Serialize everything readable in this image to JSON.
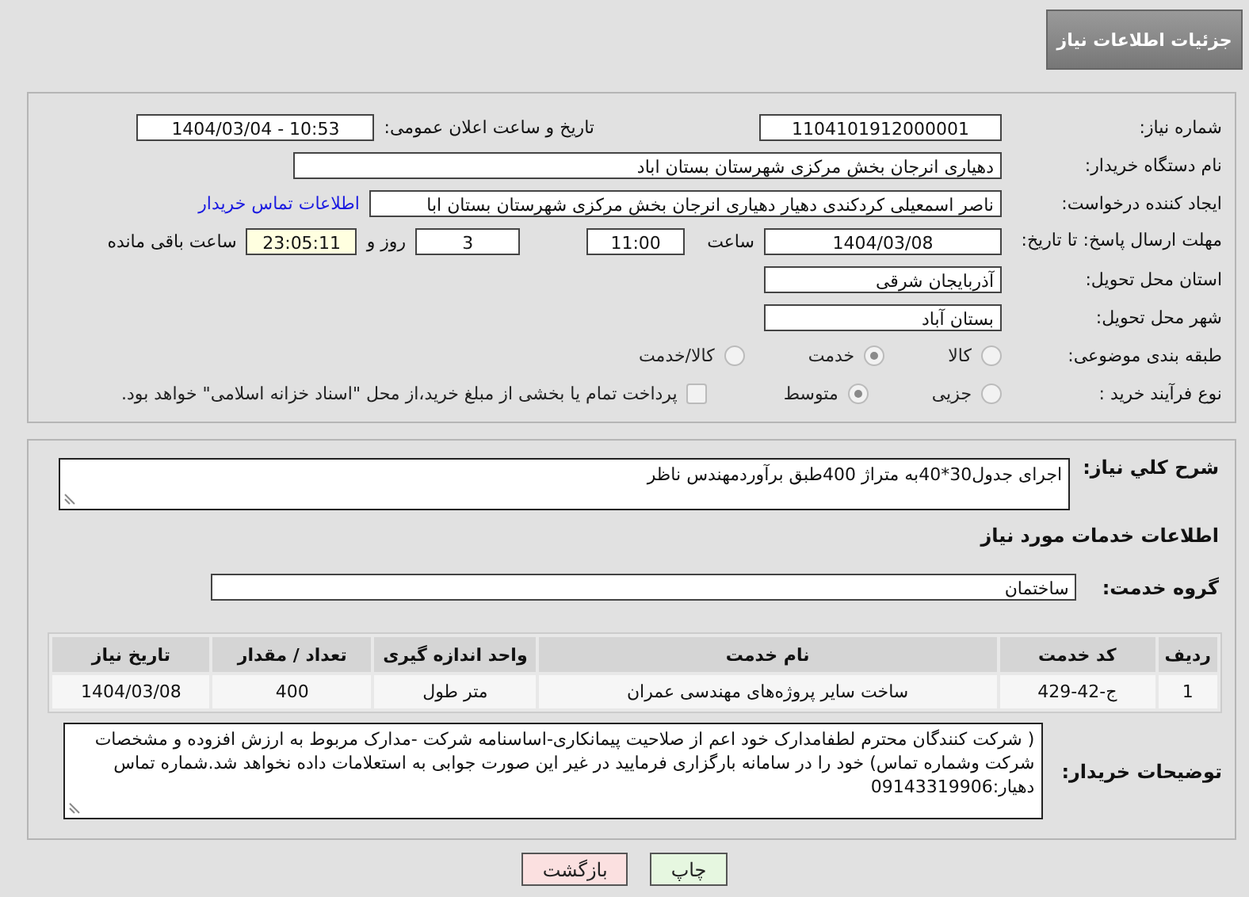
{
  "header": {
    "title": "جزئیات اطلاعات نیاز"
  },
  "details": {
    "rows": [
      {
        "kind": "pair",
        "label": "شماره نیاز:",
        "value": "1104101912000001",
        "label2": "تاریخ و ساعت اعلان عمومی:",
        "value2": "1404/03/04 - 10:53"
      },
      {
        "kind": "wide",
        "label": "نام دستگاه خریدار:",
        "value": "دهیاری انرجان بخش مرکزی شهرستان بستان اباد"
      },
      {
        "kind": "wide_link",
        "label": "ایجاد کننده درخواست:",
        "value": "ناصر اسمعیلی کردکندی دهیار دهیاری انرجان بخش مرکزی شهرستان بستان ابا",
        "link": "اطلاعات تماس خریدار"
      },
      {
        "kind": "deadline",
        "label": "مهلت ارسال پاسخ: تا تاریخ:",
        "date": "1404/03/08",
        "time_label": "ساعت",
        "time": "11:00",
        "days": "3",
        "days_label": "روز و",
        "remaining": "23:05:11",
        "remaining_label": "ساعت باقی مانده"
      },
      {
        "kind": "short",
        "label": "استان محل تحویل:",
        "value": "آذربایجان شرقی"
      },
      {
        "kind": "short",
        "label": "شهر محل تحویل:",
        "value": "بستان آباد"
      },
      {
        "kind": "radios",
        "label": "طبقه بندی موضوعی:",
        "options": [
          {
            "label": "کالا",
            "selected": false
          },
          {
            "label": "خدمت",
            "selected": true
          },
          {
            "label": "کالا/خدمت",
            "selected": false
          }
        ]
      },
      {
        "kind": "process",
        "label": "نوع فرآیند خرید :",
        "options": [
          {
            "label": "جزیی",
            "selected": false
          },
          {
            "label": "متوسط",
            "selected": true
          }
        ],
        "payment": {
          "checked": false,
          "text": "پرداخت تمام یا بخشی از مبلغ خرید،از محل \"اسناد خزانه اسلامی\" خواهد بود."
        }
      }
    ]
  },
  "services": {
    "description": {
      "label": "شرح کلي نياز:",
      "value": "اجرای جدول30*40به متراژ 400طبق برآوردمهندس ناظر"
    },
    "section_title": "اطلاعات خدمات مورد نیاز",
    "service_group": {
      "label": "گروه خدمت:",
      "value": "ساختمان"
    },
    "table": {
      "columns": [
        "ردیف",
        "کد خدمت",
        "نام خدمت",
        "واحد اندازه گیری",
        "تعداد / مقدار",
        "تاریخ نیاز"
      ],
      "rows": [
        [
          "1",
          "ج-42-429",
          "ساخت سایر پروژه‌های مهندسی عمران",
          "متر طول",
          "400",
          "1404/03/08"
        ]
      ]
    },
    "buyer_notes": {
      "label": "توضیحات خریدار:",
      "value": "( شرکت کنندگان محترم لطفامدارک خود اعم از صلاحیت پیمانکاری-اساسنامه شرکت -مدارک مربوط به ارزش افزوده و مشخصات شرکت وشماره تماس) خود را در سامانه بارگزاری فرمایید در غیر این صورت جوابی به استعلامات داده نخواهد شد.شماره تماس دهیار:09143319906"
    }
  },
  "buttons": [
    {
      "kind": "print",
      "label": "چاپ"
    },
    {
      "kind": "back",
      "label": "بازگشت"
    }
  ]
}
